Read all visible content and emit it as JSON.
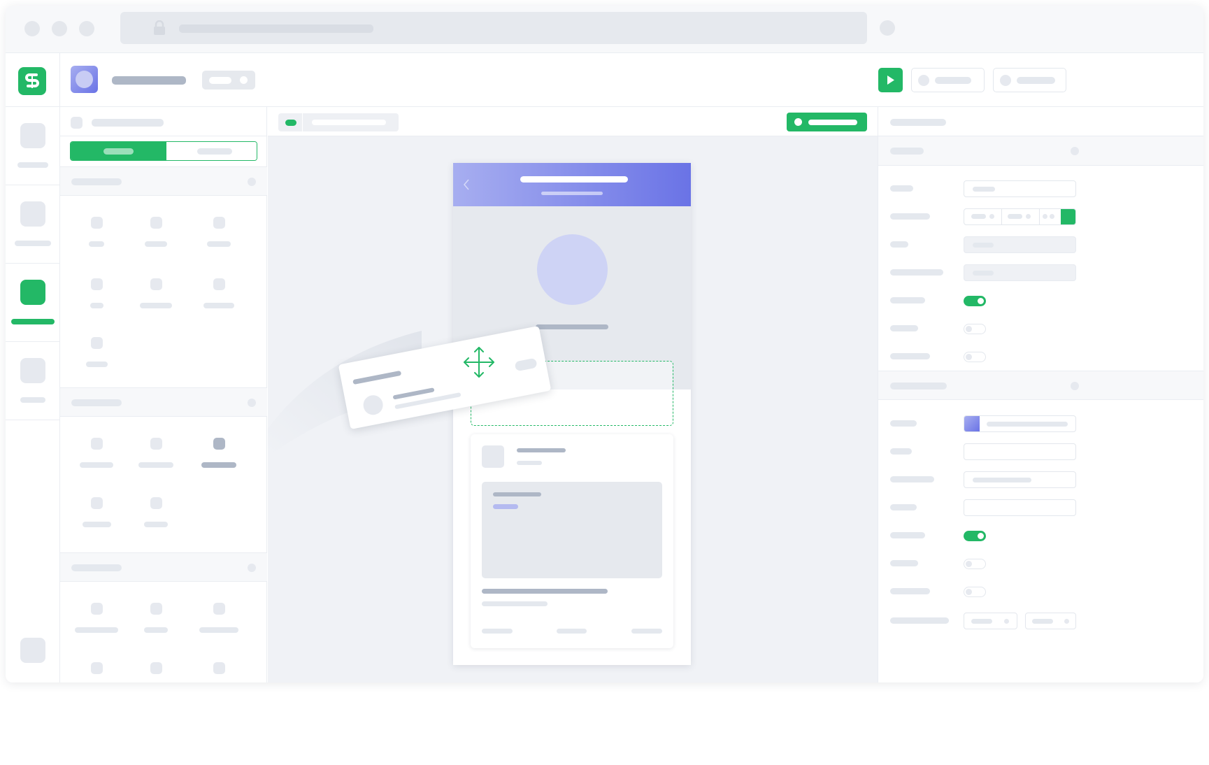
{
  "app": {
    "logo_letter": "S",
    "brand_color": "#23b866",
    "accent_gradient": [
      "#a7aef0",
      "#6a73e6"
    ],
    "icons": {
      "lock": "lock-icon",
      "run": "play-icon",
      "back": "chevron-left-icon",
      "move": "move-arrows-icon"
    }
  },
  "palette": {
    "right_panel_toggles": [
      true,
      false,
      false
    ],
    "style_toggles": [
      true,
      false,
      false
    ]
  }
}
